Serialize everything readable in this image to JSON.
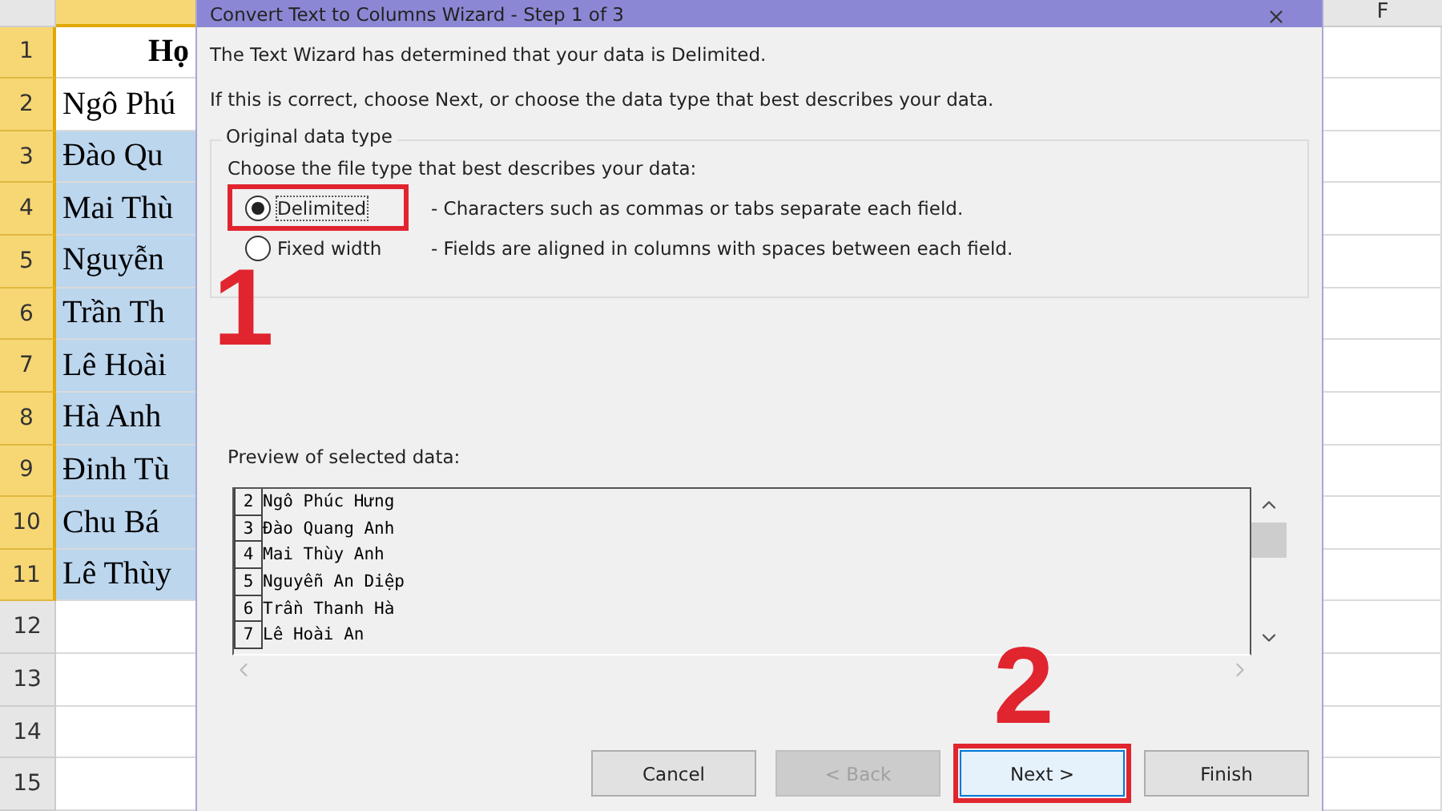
{
  "sheet": {
    "column_f_header": "F",
    "column_b_selected": true,
    "rows": [
      {
        "number": "1",
        "selected": true,
        "cell": "Họ",
        "kind": "header",
        "highlighted": false
      },
      {
        "number": "2",
        "selected": true,
        "cell": "Ngô Phú",
        "kind": "data",
        "highlighted": false
      },
      {
        "number": "3",
        "selected": true,
        "cell": "Đào Qu",
        "kind": "data",
        "highlighted": true
      },
      {
        "number": "4",
        "selected": true,
        "cell": "Mai Thù",
        "kind": "data",
        "highlighted": true
      },
      {
        "number": "5",
        "selected": true,
        "cell": "Nguyễn",
        "kind": "data",
        "highlighted": true
      },
      {
        "number": "6",
        "selected": true,
        "cell": "Trần Th",
        "kind": "data",
        "highlighted": true
      },
      {
        "number": "7",
        "selected": true,
        "cell": "Lê Hoài",
        "kind": "data",
        "highlighted": true
      },
      {
        "number": "8",
        "selected": true,
        "cell": "Hà Anh",
        "kind": "data",
        "highlighted": true
      },
      {
        "number": "9",
        "selected": true,
        "cell": "Đinh Tù",
        "kind": "data",
        "highlighted": true
      },
      {
        "number": "10",
        "selected": true,
        "cell": "Chu Bá",
        "kind": "data",
        "highlighted": true
      },
      {
        "number": "11",
        "selected": true,
        "cell": "Lê Thùy",
        "kind": "data",
        "highlighted": true
      },
      {
        "number": "12",
        "selected": false,
        "kind": "empty",
        "highlighted": false
      },
      {
        "number": "13",
        "selected": false,
        "kind": "empty",
        "highlighted": false
      },
      {
        "number": "14",
        "selected": false,
        "kind": "empty",
        "highlighted": false
      },
      {
        "number": "15",
        "selected": false,
        "kind": "empty",
        "highlighted": false
      }
    ]
  },
  "dialog": {
    "title": "Convert Text to Columns Wizard - Step 1 of 3",
    "intro": "The Text Wizard has determined that your data is Delimited.",
    "hint": "If this is correct, choose Next, or choose the data type that best describes your data.",
    "group": {
      "title": "Original data type",
      "prompt": "Choose the file type that best describes your data:",
      "options": [
        {
          "label": "Delimited",
          "description": "- Characters such as commas or tabs separate each field.",
          "selected": true
        },
        {
          "label": "Fixed width",
          "description": "- Fields are aligned in columns with spaces between each field.",
          "selected": false
        }
      ]
    },
    "preview_label": "Preview of selected data:",
    "preview_rows": [
      {
        "number": "2",
        "text": "Ngô Phúc Hưng"
      },
      {
        "number": "3",
        "text": "Đào Quang Anh"
      },
      {
        "number": "4",
        "text": "Mai Thùy Anh"
      },
      {
        "number": "5",
        "text": "Nguyễn An Diệp"
      },
      {
        "number": "6",
        "text": "Trần Thanh Hà"
      },
      {
        "number": "7",
        "text": "Lê Hoài An"
      }
    ],
    "buttons": [
      {
        "label": "Cancel",
        "disabled": false,
        "focused": false,
        "marked": false
      },
      {
        "label": "< Back",
        "disabled": true,
        "focused": false,
        "marked": false
      },
      {
        "label": "Next >",
        "disabled": false,
        "focused": true,
        "marked": true
      },
      {
        "label": "Finish",
        "disabled": false,
        "focused": false,
        "marked": false
      }
    ]
  },
  "annotations": [
    {
      "label": "1"
    },
    {
      "label": "2"
    }
  ]
}
